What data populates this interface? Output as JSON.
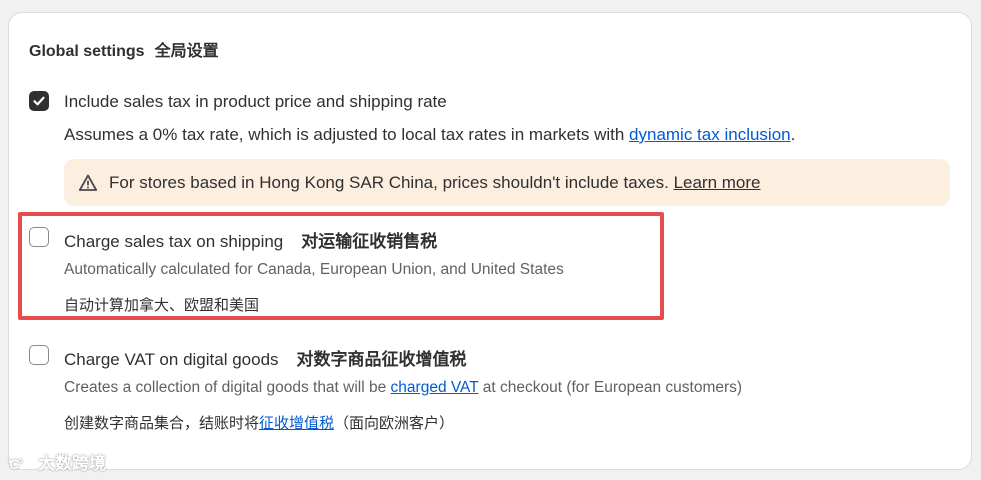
{
  "section": {
    "title": "Global settings",
    "title_zh": "全局设置"
  },
  "options": {
    "include_tax": {
      "checked": true,
      "label": "Include sales tax in product price and shipping rate",
      "help_prefix": "Assumes a 0% tax rate, which is adjusted to local tax rates in markets with ",
      "help_link": "dynamic tax inclusion",
      "help_suffix": "."
    },
    "charge_shipping": {
      "checked": false,
      "label": "Charge sales tax on shipping",
      "label_zh": "对运输征收销售税",
      "help": "Automatically calculated for Canada, European Union, and United States",
      "help_zh": "自动计算加拿大、欧盟和美国"
    },
    "charge_vat": {
      "checked": false,
      "label": "Charge VAT on digital goods",
      "label_zh": "对数字商品征收增值税",
      "help_prefix": "Creates a collection of digital goods that will be ",
      "help_link": "charged VAT",
      "help_suffix": " at checkout (for European customers)",
      "help_zh_prefix": "创建数字商品集合，结账时将",
      "help_zh_link": "征收增值税",
      "help_zh_suffix": "（面向欧洲客户）"
    }
  },
  "banner": {
    "text": "For stores based in Hong Kong SAR China, prices shouldn't include taxes. ",
    "link": "Learn more",
    "icon": "warning-triangle-icon"
  },
  "watermark": {
    "logo": "'C°",
    "text": "大数跨境"
  },
  "colors": {
    "link": "#005bd3",
    "banner_bg": "#fdefe0",
    "highlight_border": "#e74c4c",
    "checkbox_checked": "#303030"
  }
}
